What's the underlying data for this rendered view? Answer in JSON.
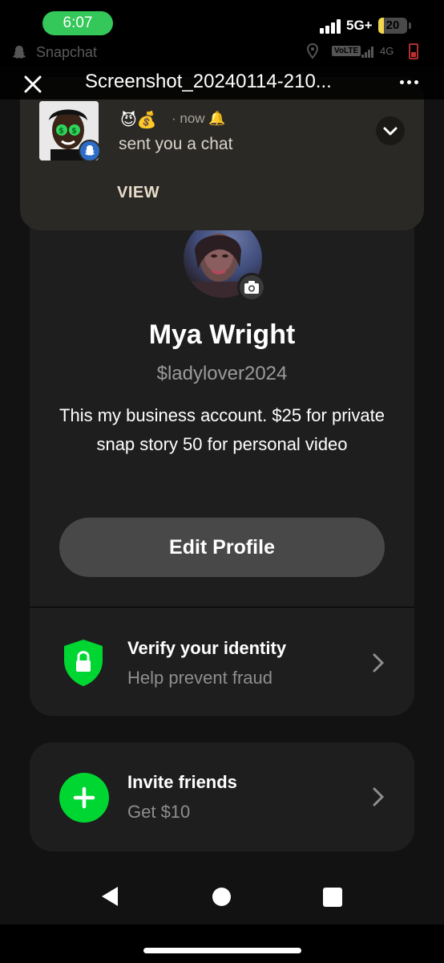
{
  "ios_status": {
    "time": "6:07",
    "network": "5G+",
    "battery": "20",
    "battery_level": 0.2
  },
  "android_status": {
    "app_name": "Snapchat",
    "volte_label": "VoLTE",
    "network_label": "4G"
  },
  "viewer": {
    "title": "Screenshot_20240114-210..."
  },
  "notification": {
    "emojis": "😈💰",
    "meta": "· now 🔔",
    "message": "sent you a chat",
    "action_label": "VIEW"
  },
  "profile": {
    "name": "Mya Wright",
    "cashtag": "$ladylover2024",
    "bio": "This my business account. $25 for private snap story 50 for personal video",
    "edit_label": "Edit Profile"
  },
  "verify": {
    "title": "Verify your identity",
    "subtitle": "Help prevent fraud"
  },
  "invite": {
    "title": "Invite friends",
    "subtitle": "Get $10"
  },
  "colors": {
    "accent_green": "#00d632",
    "card_bg": "#1e1e1e",
    "page_bg": "#121212"
  }
}
